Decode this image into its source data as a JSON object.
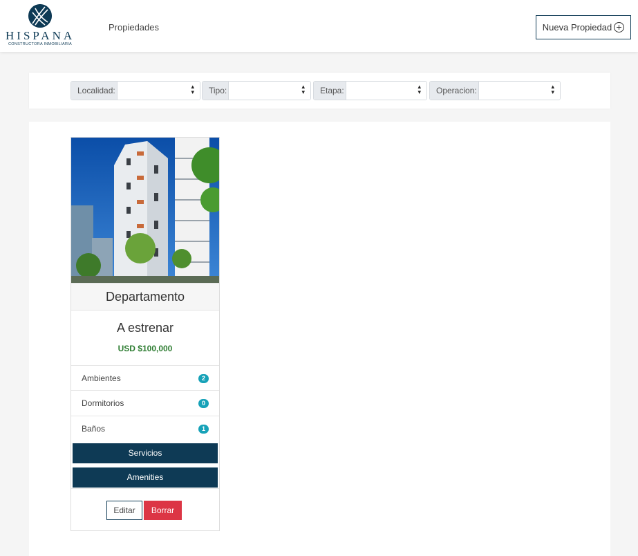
{
  "brand": {
    "name": "HISPANA",
    "tagline": "CONSTRUCTORA INMOBILIARIA"
  },
  "nav": {
    "properties_link": "Propiedades",
    "new_property_label": "Nueva Propiedad"
  },
  "filters": [
    {
      "label": "Localidad:",
      "value": ""
    },
    {
      "label": "Tipo:",
      "value": ""
    },
    {
      "label": "Etapa:",
      "value": ""
    },
    {
      "label": "Operacion:",
      "value": ""
    }
  ],
  "property": {
    "type": "Departamento",
    "status": "A estrenar",
    "price": "USD $100,000",
    "features": [
      {
        "label": "Ambientes",
        "count": "2"
      },
      {
        "label": "Dormitorios",
        "count": "0"
      },
      {
        "label": "Baños",
        "count": "1"
      }
    ],
    "services_label": "Servicios",
    "amenities_label": "Amenities",
    "edit_label": "Editar",
    "delete_label": "Borrar"
  },
  "colors": {
    "brand_navy": "#0e3a55",
    "badge_teal": "#17a2b8",
    "price_green": "#2e7d32",
    "danger_red": "#dc3545"
  }
}
